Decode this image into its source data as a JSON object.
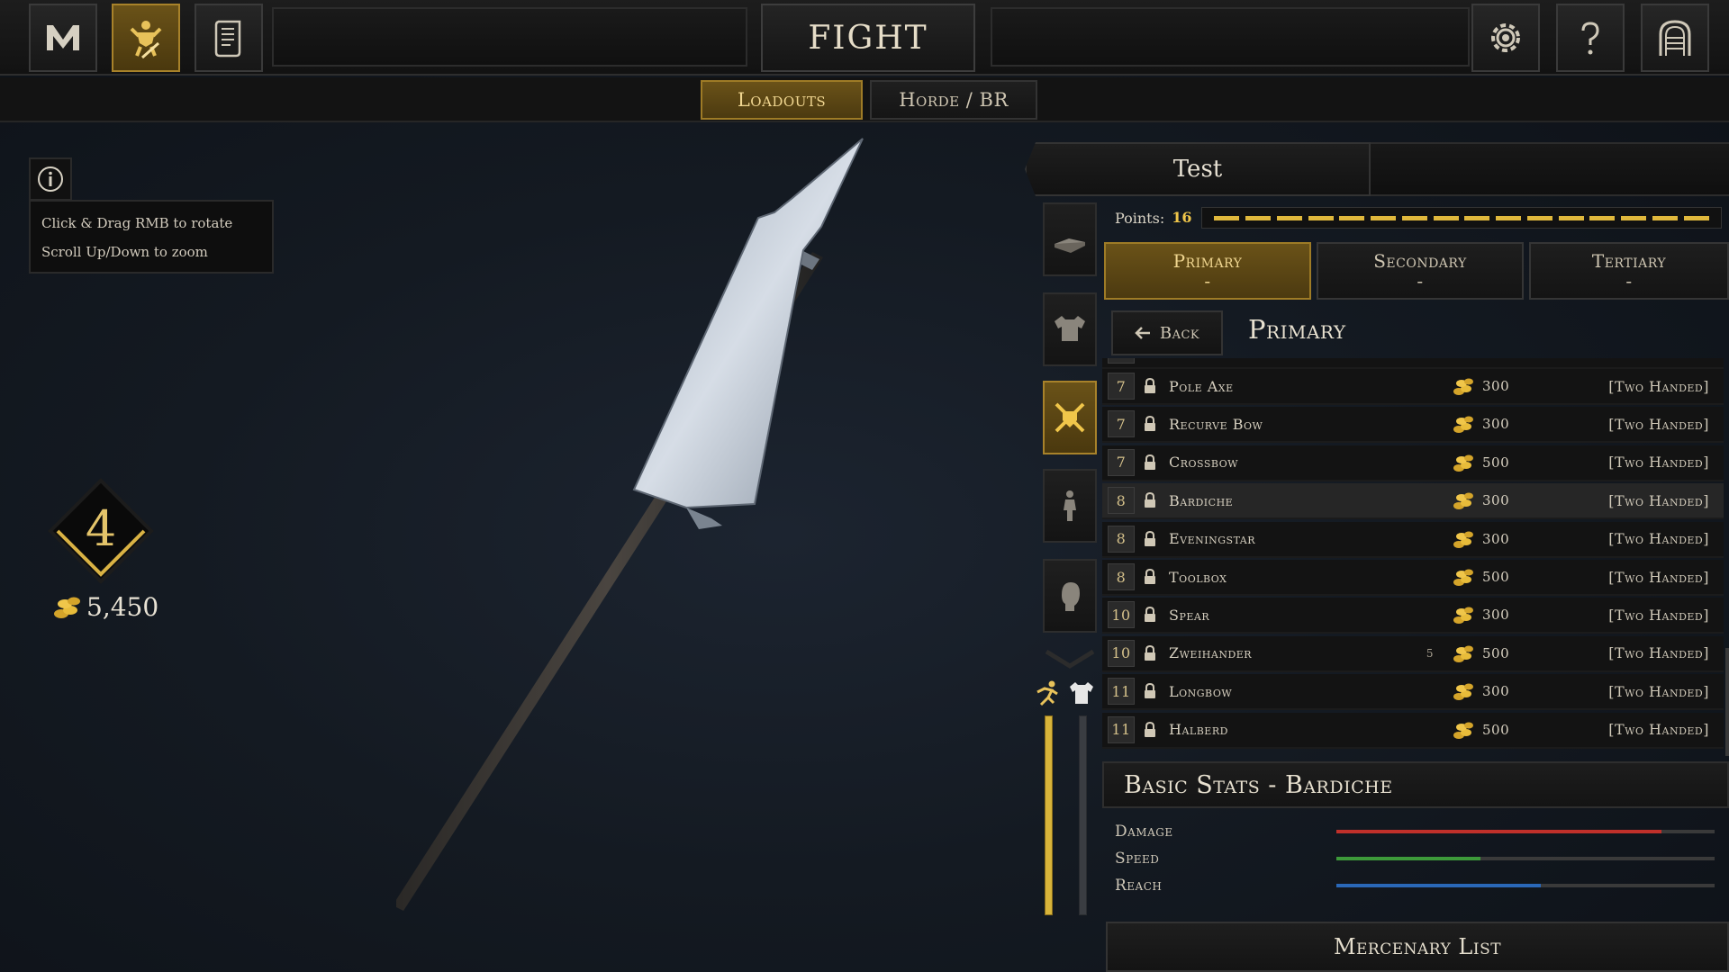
{
  "topbar": {
    "title": "FIGHT",
    "left_icons": [
      "mordhau-logo-icon",
      "loadout-warrior-icon",
      "scroll-icon"
    ],
    "right_icons": [
      "gear-icon",
      "help-icon",
      "exit-gate-icon"
    ]
  },
  "subtabs": [
    {
      "label": "Loadouts",
      "active": true
    },
    {
      "label": "Horde / BR",
      "active": false
    }
  ],
  "info": {
    "line1": "Click & Drag RMB to rotate",
    "line2": "Scroll Up/Down to zoom"
  },
  "player": {
    "level": "4",
    "gold": "5,450"
  },
  "loadout": {
    "name": "Test",
    "points_label": "Points:",
    "points_value": "16",
    "points_segments": 16
  },
  "slot_tabs": [
    {
      "label": "Primary",
      "sub": "-",
      "active": true
    },
    {
      "label": "Secondary",
      "sub": "-",
      "active": false
    },
    {
      "label": "Tertiary",
      "sub": "-",
      "active": false
    }
  ],
  "list": {
    "back_label": "Back",
    "title": "Primary",
    "rows": [
      {
        "level": "7",
        "name": "Pole Axe",
        "extra": "",
        "cost": "300",
        "type": "[Two Handed]"
      },
      {
        "level": "7",
        "name": "Recurve Bow",
        "extra": "",
        "cost": "300",
        "type": "[Two Handed]"
      },
      {
        "level": "7",
        "name": "Crossbow",
        "extra": "",
        "cost": "500",
        "type": "[Two Handed]"
      },
      {
        "level": "8",
        "name": "Bardiche",
        "extra": "",
        "cost": "300",
        "type": "[Two Handed]",
        "selected": true
      },
      {
        "level": "8",
        "name": "Eveningstar",
        "extra": "",
        "cost": "300",
        "type": "[Two Handed]"
      },
      {
        "level": "8",
        "name": "Toolbox",
        "extra": "",
        "cost": "500",
        "type": "[Two Handed]"
      },
      {
        "level": "10",
        "name": "Spear",
        "extra": "",
        "cost": "300",
        "type": "[Two Handed]"
      },
      {
        "level": "10",
        "name": "Zweihander",
        "extra": "5",
        "cost": "500",
        "type": "[Two Handed]"
      },
      {
        "level": "11",
        "name": "Longbow",
        "extra": "",
        "cost": "300",
        "type": "[Two Handed]"
      },
      {
        "level": "11",
        "name": "Halberd",
        "extra": "",
        "cost": "500",
        "type": "[Two Handed]"
      }
    ]
  },
  "stats": {
    "title": "Basic Stats - Bardiche",
    "items": [
      {
        "label": "Damage",
        "value": 0.86,
        "color": "#c0302a"
      },
      {
        "label": "Speed",
        "value": 0.38,
        "color": "#3d9a3a"
      },
      {
        "label": "Reach",
        "value": 0.54,
        "color": "#2a68b8"
      }
    ]
  },
  "bottom": {
    "mercenary_label": "Mercenary List"
  },
  "vertical_bars": {
    "stamina": 1.0,
    "armor": 1.0
  },
  "colors": {
    "accent_gold": "#a8822a",
    "gold_text": "#f0c64a"
  }
}
